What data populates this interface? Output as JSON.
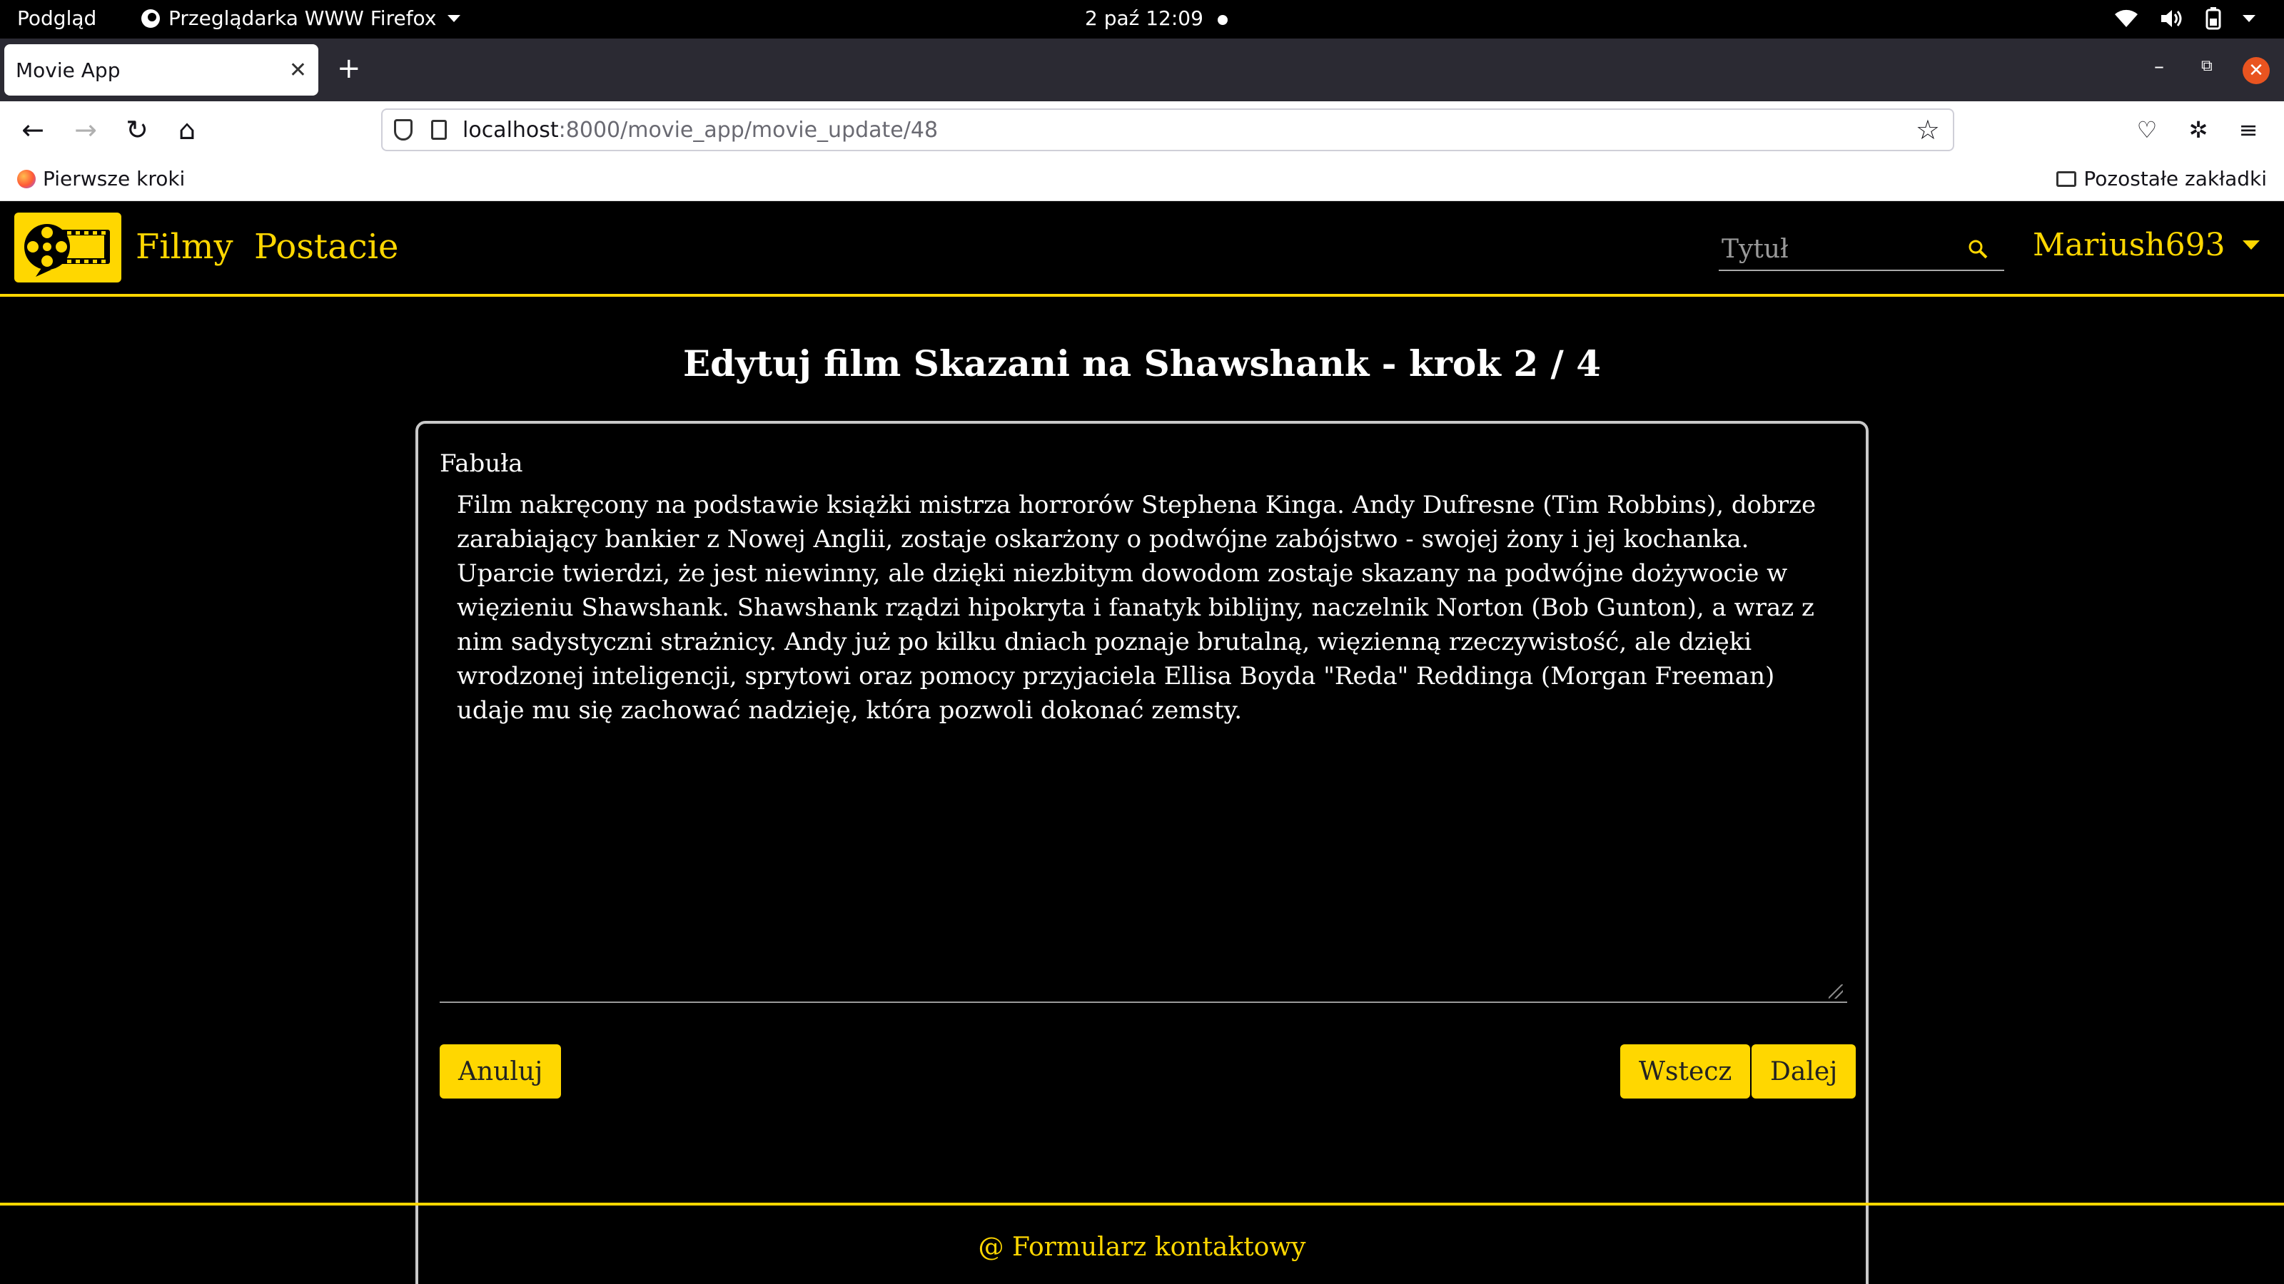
{
  "system_bar": {
    "activities": "Podgląd",
    "app_name": "Przeglądarka WWW Firefox",
    "clock": "2 paź  12:09"
  },
  "browser": {
    "tab_title": "Movie App",
    "url_host": "localhost",
    "url_path": ":8000/movie_app/movie_update/48",
    "bookmark_first": "Pierwsze kroki",
    "bookmark_other": "Pozostałe zakładki"
  },
  "site": {
    "nav": {
      "films": "Filmy",
      "characters": "Postacie",
      "search_placeholder": "Tytuł",
      "user": "Mariush693"
    },
    "colors": {
      "accent": "#ffd700",
      "background": "#000000"
    },
    "page_title": "Edytuj film Skazani na Shawshank - krok 2 / 4",
    "form": {
      "plot_label": "Fabuła",
      "plot_text": "Film nakręcony na podstawie książki mistrza horrorów Stephena Kinga. Andy Dufresne (Tim Robbins), dobrze zarabiający bankier z Nowej Anglii, zostaje oskarżony o podwójne zabójstwo - swojej żony i jej kochanka. Uparcie twierdzi, że jest niewinny, ale dzięki niezbitym dowodom zostaje skazany na podwójne dożywocie w więzieniu Shawshank. Shawshank rządzi hipokryta i fanatyk biblijny, naczelnik Norton (Bob Gunton), a wraz z nim sadystyczni strażnicy. Andy już po kilku dniach poznaje brutalną, więzienną rzeczywistość, ale dzięki wrodzonej inteligencji, sprytowi oraz pomocy przyjaciela Ellisa Boyda \"Reda\" Reddinga (Morgan Freeman) udaje mu się zachować nadzieję, która pozwoli dokonać zemsty.",
      "cancel": "Anuluj",
      "back": "Wstecz",
      "next": "Dalej"
    },
    "footer": {
      "contact": "@ Formularz kontaktowy"
    }
  }
}
